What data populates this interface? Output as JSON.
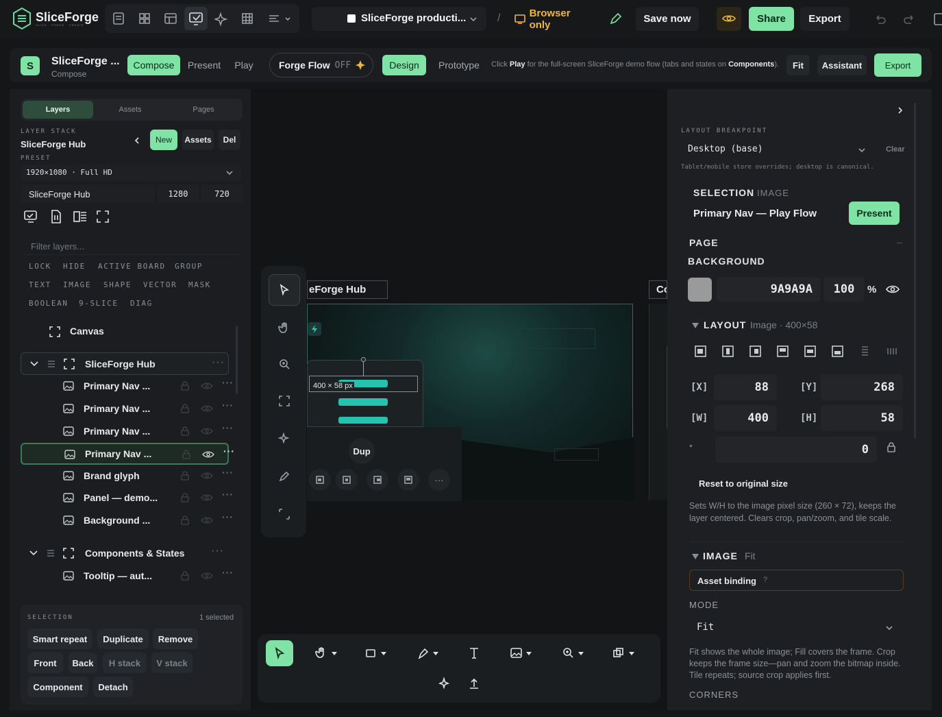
{
  "app": {
    "name": "SliceForge",
    "tagline": "SLICE · FORGE · CREATE"
  },
  "topbar": {
    "doc_title": "SliceForge producti...",
    "separator": "/",
    "browser_only": "Browser only",
    "save_now": "Save now",
    "share": "Share",
    "export": "Export"
  },
  "project": {
    "avatar": "S",
    "name": "SliceForge ...",
    "mode": "Compose",
    "tabs": [
      "Compose",
      "Present",
      "Play"
    ],
    "forge_flow": "Forge Flow",
    "forge_state": "OFF",
    "design": "Design",
    "prototype": "Prototype",
    "hint_pre": "Click ",
    "hint_play": "Play",
    "hint_mid": " for the full-screen SliceForge demo flow (tabs and states on ",
    "hint_comp": "Components",
    "hint_end": ").",
    "fit": "Fit",
    "assistant": "Assistant",
    "export": "Export"
  },
  "left": {
    "tabs": [
      "Layers",
      "Assets",
      "Pages"
    ],
    "layer_stack_label": "LAYER STACK",
    "layer_stack_name": "SliceForge Hub",
    "new": "New",
    "assets": "Assets",
    "del": "Del",
    "preset_label": "PRESET",
    "preset_value": "1920×1080 · Full HD",
    "board_name": "SliceForge Hub",
    "board_w": "1280",
    "board_h": "720",
    "filter_placeholder": "Filter layers...",
    "tags": [
      "LOCK",
      "HIDE",
      "ACTIVE BOARD",
      "GROUP",
      "TEXT",
      "IMAGE",
      "SHAPE",
      "VECTOR",
      "MASK",
      "BOOLEAN",
      "9-SLICE",
      "DIAG"
    ],
    "canvas_item": "Canvas",
    "group1": "SliceForge Hub",
    "layers": [
      "Primary Nav ...",
      "Primary Nav ...",
      "Primary Nav ...",
      "Primary Nav ...",
      "Brand glyph",
      "Panel — demo...",
      "Background ..."
    ],
    "group2": "Components & States",
    "layers2": [
      "Tooltip — aut..."
    ],
    "selection_label": "SELECTION",
    "selection_count": "1 selected",
    "sel_buttons": [
      "Smart repeat",
      "Duplicate",
      "Remove",
      "Front",
      "Back",
      "H stack",
      "V stack",
      "Component",
      "Detach"
    ]
  },
  "canvas": {
    "board_label": "eForge Hub",
    "board2_label": "Co",
    "size_badge": "400 × 58 px",
    "dup": "Dup"
  },
  "right": {
    "bp_label": "LAYOUT BREAKPOINT",
    "bp_value": "Desktop (base)",
    "bp_clear": "Clear",
    "bp_note": "Tablet/mobile store overrides; desktop is canonical.",
    "selection_label": "SELECTION",
    "selection_kind": "IMAGE",
    "selection_name": "Primary Nav — Play Flow",
    "present": "Present",
    "page_label": "PAGE",
    "background_label": "BACKGROUND",
    "bg_color": "#9A9A9A",
    "bg_hex": "9A9A9A",
    "bg_opacity": "100",
    "pct": "%",
    "layout_label": "LAYOUT",
    "layout_meta": "Image · 400×58",
    "x_label": "[X]",
    "x": "88",
    "y_label": "[Y]",
    "y": "268",
    "w_label": "[W]",
    "w": "400",
    "h_label": "[H]",
    "h": "58",
    "rot_label": "°",
    "rot": "0",
    "reset": "Reset to original size",
    "reset_note": "Sets W/H to the image pixel size (260 × 72), keeps the layer centered. Clears crop, pan/zoom, and tile scale.",
    "image_label": "IMAGE",
    "image_meta": "Fit",
    "asset_binding": "Asset binding",
    "asset_q": "?",
    "mode_label": "MODE",
    "mode_value": "Fit",
    "mode_note": "Fit shows the whole image; Fill covers the frame. Crop keeps the frame size—pan and zoom the bitmap inside. Tile repeats; source crop applies first.",
    "corners": "CORNERS"
  },
  "colors": {
    "accent": "#7fe3a6",
    "teal": "#2bc7b4",
    "panel": "#1b1d20",
    "bg": "#141618"
  }
}
